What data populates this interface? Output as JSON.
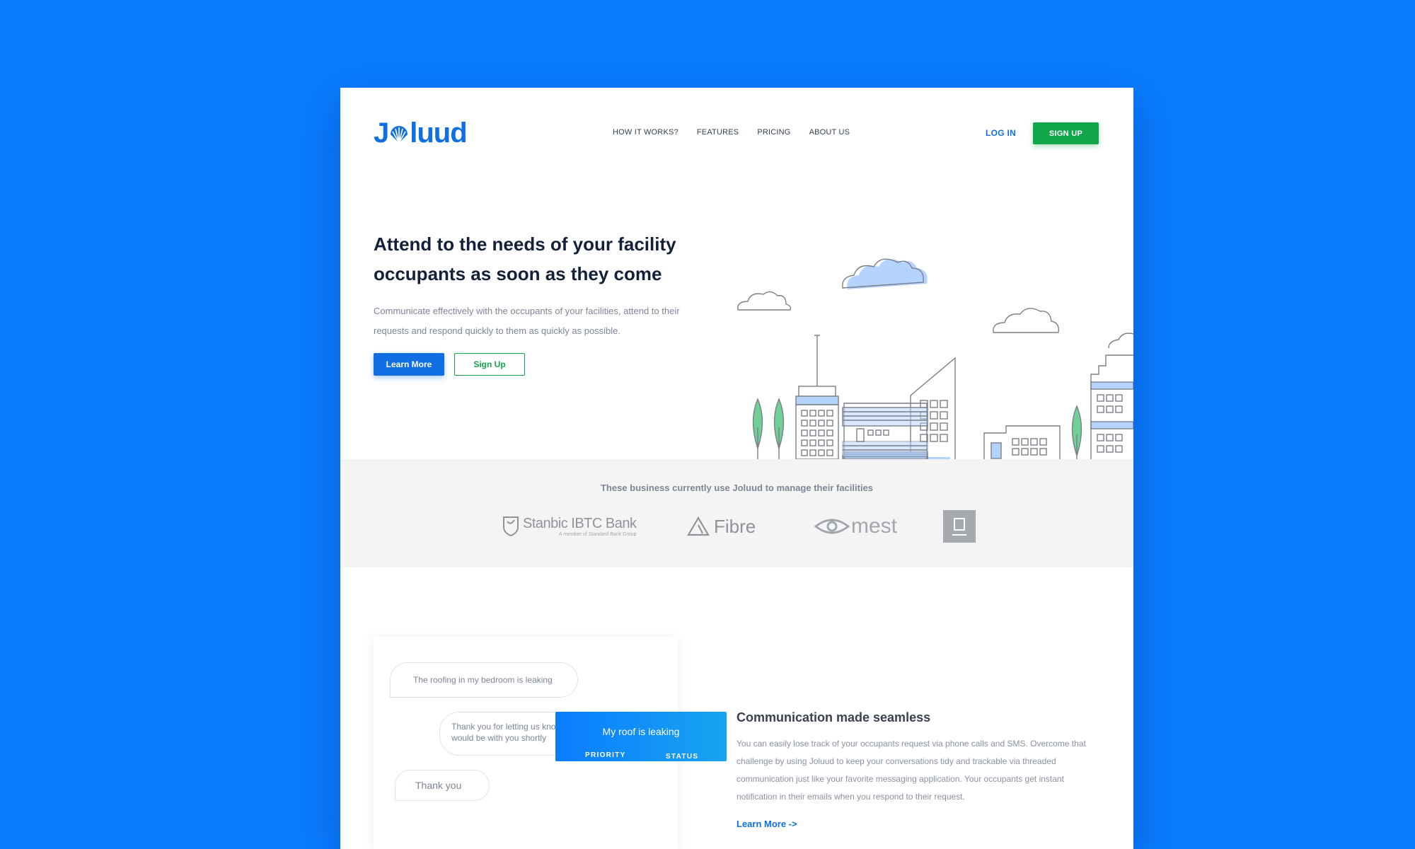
{
  "brand": {
    "logo_left": "J",
    "logo_right": "luud"
  },
  "nav": {
    "links": [
      "HOW IT WORKS?",
      "FEATURES",
      "PRICING",
      "ABOUT US"
    ],
    "login": "LOG IN",
    "signup": "SIGN UP"
  },
  "hero": {
    "title": "Attend to the needs of your  facility occupants as soon as they come",
    "subtitle": "Communicate effectively with the occupants of your facilities, attend to their requests and respond quickly to them as quickly as possible.",
    "learn_more": "Learn More",
    "sign_up": "Sign Up"
  },
  "clients": {
    "caption": "These business currently use Joluud to manage their facilities",
    "logos": [
      {
        "name": "Stanbic IBTC Bank",
        "sub": "A member of Standard Bank Group"
      },
      {
        "name": "Fibre"
      },
      {
        "name": "mest"
      }
    ]
  },
  "chat": {
    "messages": [
      "The roofing in my bedroom is leaking",
      "Thank you for letting us know. A plumber would be with you shortly",
      "Thank you"
    ]
  },
  "ticket": {
    "title": "My roof is leaking",
    "priority_label": "PRIORITY",
    "status_label": "STATUS"
  },
  "feature": {
    "title": "Communication made seamless",
    "body": "You can easily lose track of your occupants request via phone calls and SMS. Overcome that challenge by using Joluud to keep your conversations tidy and trackable via threaded communication just like your favorite messaging application. Your occupants get instant notification in their emails when you respond to their request.",
    "link": "Learn More ->"
  },
  "colors": {
    "background": "#0a7cff",
    "brand_blue": "#0f6fe3",
    "brand_green": "#12a64b",
    "illustration_blue": "#b5d3ff",
    "tree_green": "#6fcf97"
  }
}
